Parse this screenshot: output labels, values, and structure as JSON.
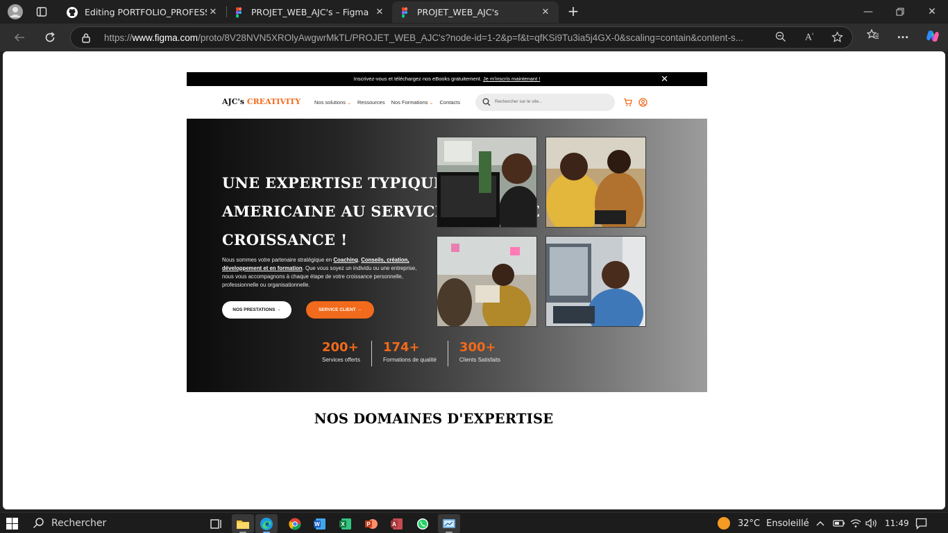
{
  "browser": {
    "tabs": [
      {
        "title": "Editing PORTFOLIO_PROFESSIONNEL",
        "favicon": "github-icon",
        "active": false
      },
      {
        "title": "PROJET_WEB_AJC's – Figma",
        "favicon": "figma-icon",
        "active": false
      },
      {
        "title": "PROJET_WEB_AJC's",
        "favicon": "figma-icon",
        "active": true
      }
    ],
    "url_prefix": "https://",
    "url_domain": "www.figma.com",
    "url_path": "/proto/8V28NVN5XROlyAwgwrMkTL/PROJET_WEB_AJC's?node-id=1-2&p=f&t=qfKSi9Tu3ia5j4GX-0&scaling=contain&content-s..."
  },
  "site": {
    "promo_text": "Inscrivez-vous et téléchargez nos eBooks gratuitement.",
    "promo_link": "Je m'inscris maintenant !",
    "logo_main": "AJC's",
    "logo_accent": "CREATIVITY",
    "nav": [
      {
        "label": "Nos solutions",
        "dropdown": true
      },
      {
        "label": "Ressources",
        "dropdown": false
      },
      {
        "label": "Nos Formations",
        "dropdown": true
      },
      {
        "label": "Contacts",
        "dropdown": false
      }
    ],
    "search_placeholder": "Rechercher sur le site...",
    "accent_color": "#f26a1b",
    "hero": {
      "title_line1": "UNE EXPERTISE TYPIQUEMENT",
      "title_line2": "AMERICAINE AU SERVICE DE VOTRE",
      "title_line3": "CROISSANCE !",
      "lead_1": "Nous sommes votre partenaire stratégique en",
      "lead_hl1": "Coaching",
      "lead_sep1": ",",
      "lead_hl2": "Conseils, création, développement et en formation",
      "lead_2": ". Que vous soyez un individu ou une entreprise, nous vous accompagnons à chaque étape de votre croissance personnelle, professionnelle ou organisationnelle.",
      "btn_primary": "NOS PRESTATIONS →",
      "btn_secondary": "SERVICE CLIENT →"
    },
    "stats": [
      {
        "value": "200+",
        "label": "Services offerts"
      },
      {
        "value": "174+",
        "label": "Formations de qualité"
      },
      {
        "value": "300+",
        "label": "Clients Satisfaits"
      }
    ],
    "section_title": "NOS DOMAINES D'EXPERTISE"
  },
  "taskbar": {
    "search_label": "Rechercher",
    "weather_temp": "32°C",
    "weather_desc": "Ensoleillé",
    "time": "11:49"
  }
}
